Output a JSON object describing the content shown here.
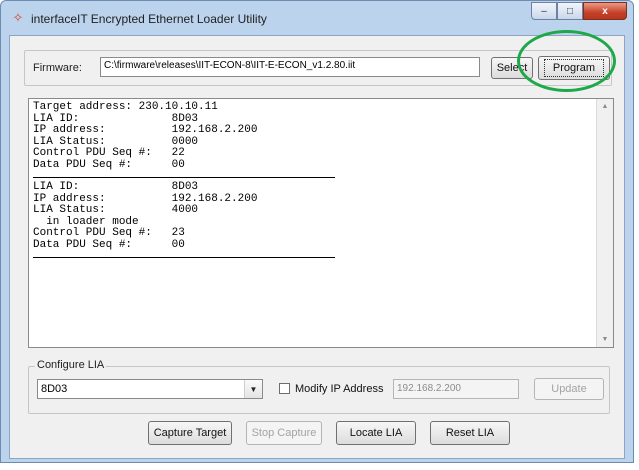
{
  "window": {
    "title": "interfaceIT Encrypted Ethernet Loader Utility",
    "icon": "diamond-app-icon",
    "minimize_glyph": "–",
    "maximize_glyph": "□",
    "close_glyph": "x"
  },
  "firmware": {
    "label": "Firmware:",
    "path": "C:\\firmware\\releases\\IIT-ECON-8\\IIT-E-ECON_v1.2.80.iit",
    "select_label": "Select",
    "program_label": "Program",
    "highlight_color": "#1fa84a"
  },
  "log": {
    "lines": [
      "Target address: 230.10.10.11",
      "LIA ID:              8D03",
      "IP address:          192.168.2.200",
      "LIA Status:          0000",
      "Control PDU Seq #:   22",
      "Data PDU Seq #:      00"
    ],
    "lines2": [
      "LIA ID:              8D03",
      "IP address:          192.168.2.200",
      "LIA Status:          4000",
      "  in loader mode",
      "Control PDU Seq #:   23",
      "Data PDU Seq #:      00"
    ],
    "scroll_up": "▲",
    "scroll_down": "▼"
  },
  "configure": {
    "legend": "Configure LIA",
    "lia_selected": "8D03",
    "combo_arrow": "▼",
    "modify_ip_label": "Modify IP Address",
    "modify_ip_checked": false,
    "ip_value": "192.168.2.200",
    "update_label": "Update"
  },
  "actions": {
    "capture_target": "Capture Target",
    "stop_capture": "Stop Capture",
    "locate_lia": "Locate LIA",
    "reset_lia": "Reset LIA"
  }
}
